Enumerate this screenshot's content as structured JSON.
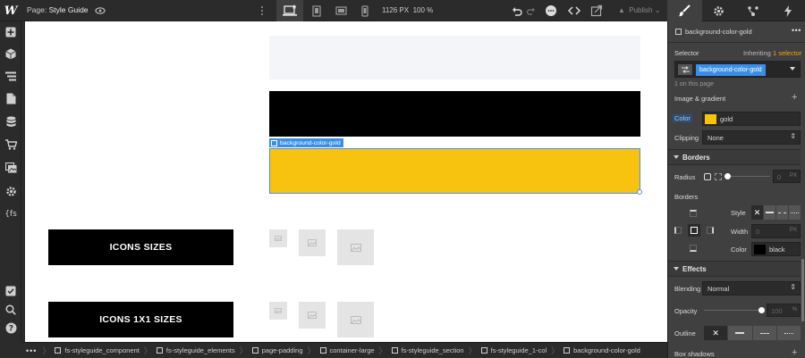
{
  "topbar": {
    "page_prefix": "Page:",
    "page_name": "Style Guide",
    "width_label": "1126 PX",
    "zoom_label": "100 %",
    "publish_label": "Publish"
  },
  "canvas": {
    "selected_element": "background-color-gold",
    "colors": {
      "light": "#f3f5f8",
      "black": "#000000",
      "gold": "#f8c30f"
    },
    "icon_rows": [
      {
        "label": "ICONS SIZES"
      },
      {
        "label": "ICONS 1X1 SIZES"
      }
    ]
  },
  "breadcrumb": {
    "more": "•••",
    "items": [
      "fs-styleguide_component",
      "fs-styleguide_elements",
      "page-padding",
      "container-large",
      "fs-styleguide_section",
      "fs-styleguide_1-col",
      "background-color-gold"
    ]
  },
  "panel": {
    "element_name": "background-color-gold",
    "selector_label": "Selector",
    "inheriting_prefix": "Inheriting",
    "inheriting_link": "1 selector",
    "selector_chip": "background-color-gold",
    "on_page": "1 on this page",
    "image_gradient": "Image & gradient",
    "color_label": "Color",
    "color_value": "gold",
    "color_hex": "#f8c30f",
    "clipping_label": "Clipping",
    "clipping_value": "None",
    "borders_section": "Borders",
    "radius_label": "Radius",
    "radius_value": "0",
    "radius_unit": "PX",
    "borders_label": "Borders",
    "style_label": "Style",
    "width_label": "Width",
    "width_value": "0",
    "width_unit": "PX",
    "bcolor_label": "Color",
    "bcolor_value": "black",
    "effects_section": "Effects",
    "blending_label": "Blending",
    "blending_value": "Normal",
    "opacity_label": "Opacity",
    "opacity_value": "100",
    "opacity_unit": "%",
    "outline_label": "Outline",
    "box_shadows_label": "Box shadows"
  }
}
